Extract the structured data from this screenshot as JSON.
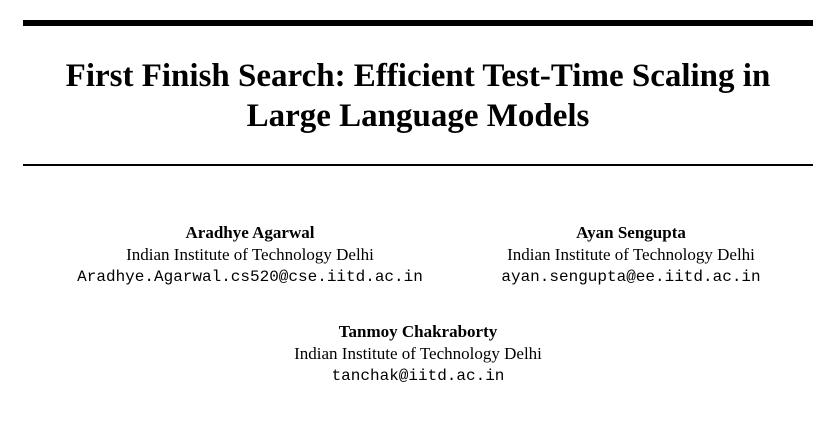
{
  "paper": {
    "title": "First Finish Search: Efficient Test-Time Scaling in\nLarge Language Models"
  },
  "authors": [
    {
      "name": "Aradhye Agarwal",
      "affiliation": "Indian Institute of Technology Delhi",
      "email": "Aradhye.Agarwal.cs520@cse.iitd.ac.in"
    },
    {
      "name": "Ayan Sengupta",
      "affiliation": "Indian Institute of Technology Delhi",
      "email": "ayan.sengupta@ee.iitd.ac.in"
    },
    {
      "name": "Tanmoy Chakraborty",
      "affiliation": "Indian Institute of Technology Delhi",
      "email": "tanchak@iitd.ac.in"
    }
  ]
}
